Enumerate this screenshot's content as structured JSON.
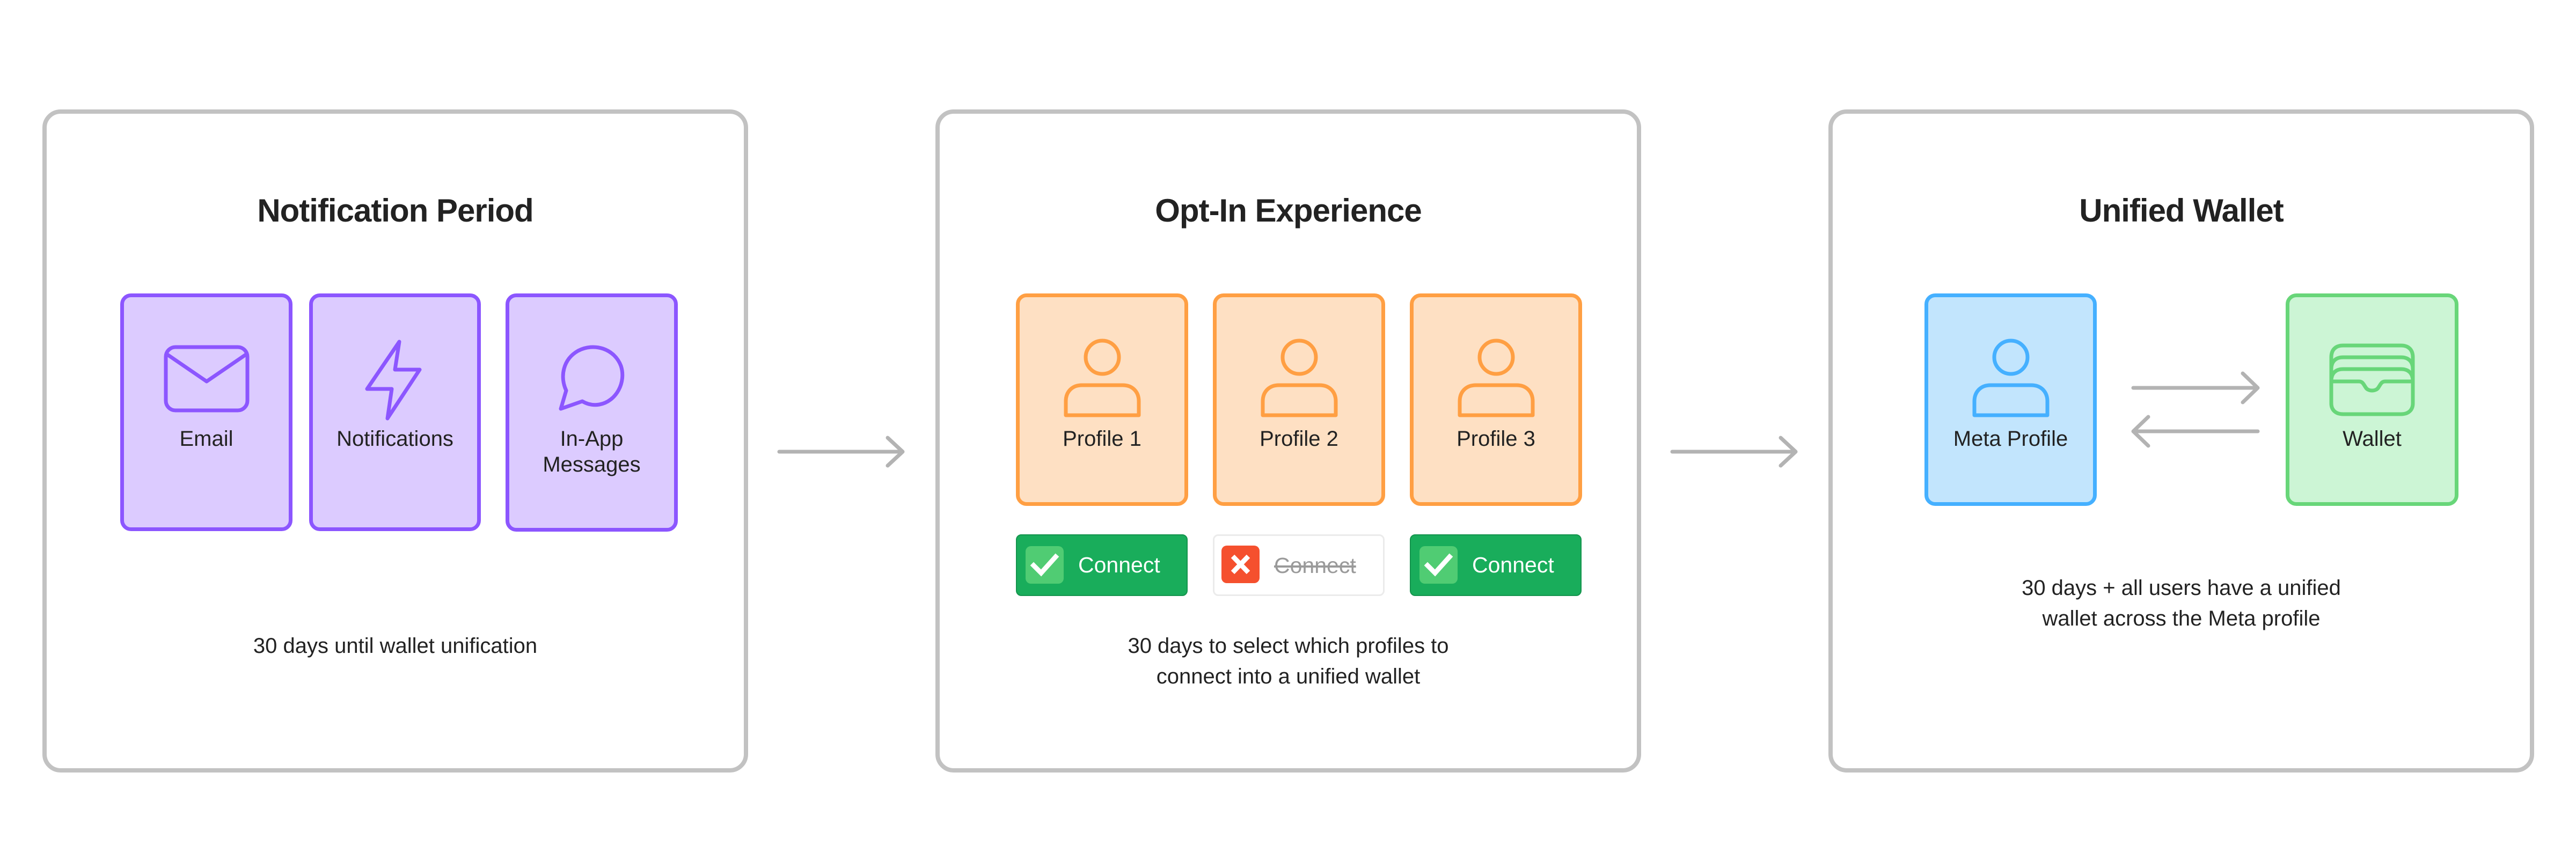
{
  "colors": {
    "panel_border": "#c2c2c2",
    "arrow": "#b3b3b3",
    "purple_border": "#8c56ff",
    "purple_fill": "#dccbff",
    "orange_border": "#ff9f43",
    "orange_fill": "#fee0c3",
    "blue_border": "#45b0ff",
    "blue_fill": "#c2e5fd",
    "green_border": "#68d679",
    "green_fill": "#ccf5d5",
    "connect_on": "#19ad5b",
    "connect_off_icon": "#f5502e"
  },
  "stages": [
    {
      "title": "Notification Period",
      "tiles": [
        {
          "label": "Email",
          "icon": "envelope-icon"
        },
        {
          "label": "Notifications",
          "icon": "lightning-bolt-icon"
        },
        {
          "label": "In-App Messages",
          "icon": "chat-bubble-icon"
        }
      ],
      "description_lines": [
        "30 days until wallet unification"
      ]
    },
    {
      "title": "Opt-In Experience",
      "tiles": [
        {
          "label": "Profile 1",
          "icon": "person-icon"
        },
        {
          "label": "Profile 2",
          "icon": "person-icon"
        },
        {
          "label": "Profile 3",
          "icon": "person-icon"
        }
      ],
      "connect_buttons": [
        {
          "label": "Connect",
          "state": "selected",
          "icon": "checkmark-icon"
        },
        {
          "label": "Connect",
          "state": "declined",
          "icon": "x-icon"
        },
        {
          "label": "Connect",
          "state": "selected",
          "icon": "checkmark-icon"
        }
      ],
      "description_lines": [
        "30 days to select which profiles to",
        "connect into a unified wallet"
      ]
    },
    {
      "title": "Unified Wallet",
      "tiles": [
        {
          "label": "Meta Profile",
          "icon": "person-icon"
        },
        {
          "label": "Wallet",
          "icon": "wallet-icon"
        }
      ],
      "exchange_icon": "bidirectional-arrows-icon",
      "description_lines": [
        "30 days + all users have a unified",
        "wallet across the Meta profile"
      ]
    }
  ],
  "flow_arrows": [
    {
      "from": "Notification Period",
      "to": "Opt-In Experience"
    },
    {
      "from": "Opt-In Experience",
      "to": "Unified Wallet"
    }
  ]
}
